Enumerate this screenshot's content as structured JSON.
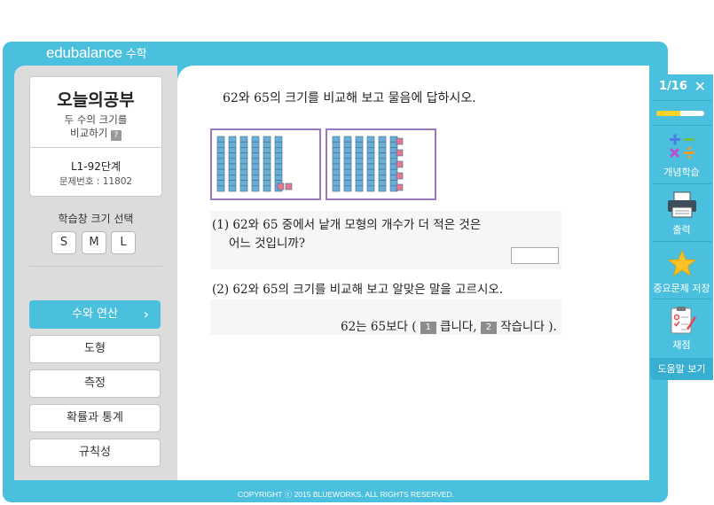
{
  "brand": {
    "logo": "edubalance",
    "subject": "수학"
  },
  "lesson": {
    "title": "오늘의공부",
    "subtitle_line1": "두 수의 크기를",
    "subtitle_line2": "비교하기",
    "help_badge": "?",
    "level": "L1-92단계",
    "problem_number": "문제번호 : 11802"
  },
  "size_select": {
    "label": "학습창 크기 선택",
    "options": [
      "S",
      "M",
      "L"
    ]
  },
  "menu": [
    {
      "label": "수와 연산",
      "active": true
    },
    {
      "label": "도형",
      "active": false
    },
    {
      "label": "측정",
      "active": false
    },
    {
      "label": "확률과 통계",
      "active": false
    },
    {
      "label": "규칙성",
      "active": false
    }
  ],
  "menu_chevron": "›",
  "question": {
    "title": "62와 65의 크기를 비교해 보고 물음에 답하시오.",
    "blocks": [
      {
        "tens": 6,
        "ones": 2
      },
      {
        "tens": 6,
        "ones": 5
      }
    ],
    "q1_line1": "(1) 62와 65 중에서 낱개 모형의 개수가 더 적은 것은",
    "q1_line2": "어느 것입니까?",
    "q2": "(2) 62와 65의 크기를 비교해 보고 알맞은 말을 고르시오.",
    "q2_answer_prefix": "62는 65보다 (",
    "choice1_num": "1",
    "choice1_text": "큽니다,",
    "choice2_num": "2",
    "choice2_text": "작습니다 )."
  },
  "footer": {
    "copyright": "COPYRIGHT ⓒ 2015 BLUEWORKS. ALL RIGHTS RESERVED."
  },
  "right_panel": {
    "page_indicator": "1/16",
    "close_symbol": "✕",
    "progress": 0.5,
    "items": [
      {
        "label": "개념학습",
        "icon": "math-operators-icon"
      },
      {
        "label": "출력",
        "icon": "printer-icon"
      },
      {
        "label": "중요문제 저장",
        "icon": "star-icon"
      },
      {
        "label": "채점",
        "icon": "grading-clipboard-icon"
      }
    ],
    "help_view": "도움말 보기"
  },
  "colors": {
    "accent": "#4ac0de",
    "block_blue": "#6aaed6",
    "block_pink": "#e6788f",
    "border_purple": "#9a78b9",
    "progress_yellow": "#f8d12a"
  }
}
